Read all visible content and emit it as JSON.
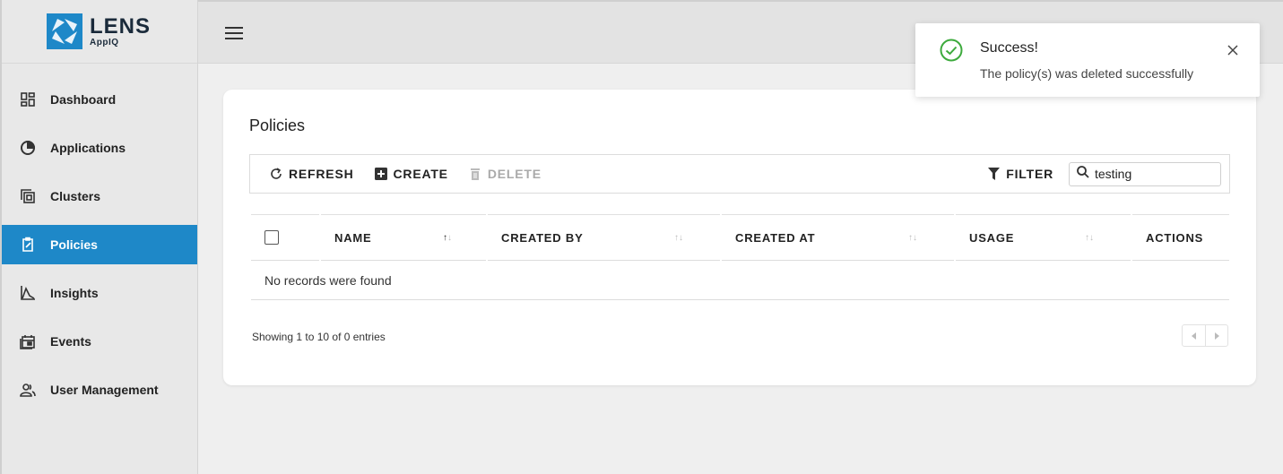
{
  "brand": {
    "title": "LENS",
    "subtitle": "AppIQ",
    "logo_color": "#1e88c8"
  },
  "sidebar": {
    "items": [
      {
        "label": "Dashboard",
        "icon": "dashboard-icon",
        "active": false
      },
      {
        "label": "Applications",
        "icon": "applications-icon",
        "active": false
      },
      {
        "label": "Clusters",
        "icon": "clusters-icon",
        "active": false
      },
      {
        "label": "Policies",
        "icon": "policies-icon",
        "active": true
      },
      {
        "label": "Insights",
        "icon": "insights-icon",
        "active": false
      },
      {
        "label": "Events",
        "icon": "events-icon",
        "active": false
      },
      {
        "label": "User Management",
        "icon": "user-management-icon",
        "active": false
      }
    ],
    "active_color": "#1e88c8"
  },
  "page": {
    "title": "Policies"
  },
  "toolbar": {
    "refresh_label": "REFRESH",
    "create_label": "CREATE",
    "delete_label": "DELETE",
    "filter_label": "FILTER",
    "search_value": "testing"
  },
  "table": {
    "columns": [
      {
        "label": "NAME",
        "sort": "asc"
      },
      {
        "label": "CREATED BY",
        "sort": "none"
      },
      {
        "label": "CREATED AT",
        "sort": "none"
      },
      {
        "label": "USAGE",
        "sort": "none"
      },
      {
        "label": "ACTIONS",
        "sort": null
      }
    ],
    "empty_message": "No records were found",
    "footer": "Showing 1 to 10 of 0 entries"
  },
  "toast": {
    "title": "Success!",
    "message": "The policy(s) was deleted successfully",
    "status_color": "#3daa3d"
  }
}
